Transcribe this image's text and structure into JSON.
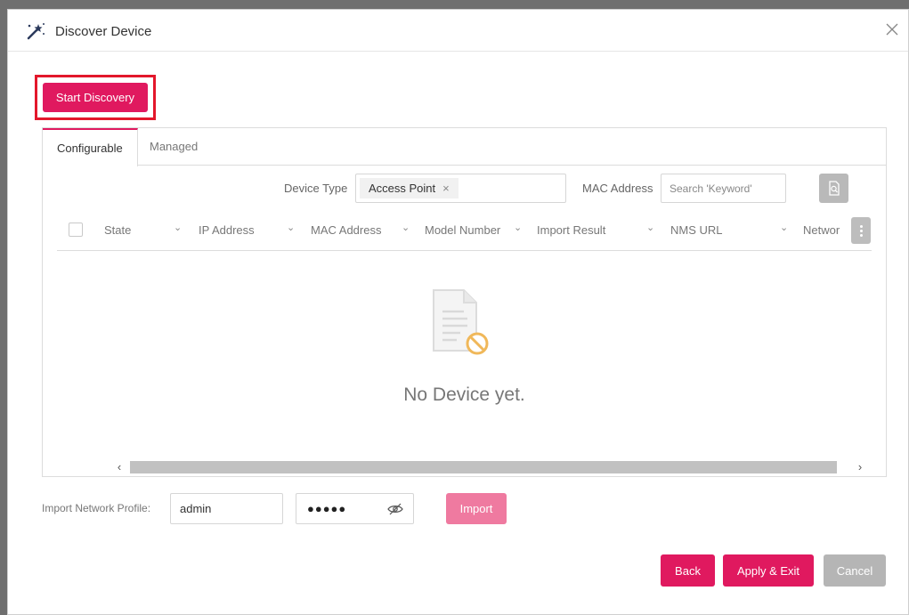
{
  "dialog": {
    "title": "Discover Device",
    "title_icon": "magic-wand-icon",
    "close_icon": "close-icon"
  },
  "toolbar": {
    "start_discovery_label": "Start Discovery"
  },
  "tabs": [
    {
      "label": "Configurable",
      "active": true
    },
    {
      "label": "Managed",
      "active": false
    }
  ],
  "filters": {
    "device_type_label": "Device Type",
    "device_type_chip": "Access Point",
    "chip_remove": "×",
    "mac_label": "MAC Address",
    "search_placeholder": "Search 'Keyword'",
    "search_icon": "search-document-icon"
  },
  "table": {
    "columns": [
      "State",
      "IP Address",
      "MAC Address",
      "Model Number",
      "Import Result",
      "NMS URL",
      "Networ"
    ],
    "rows": [],
    "empty_text": "No Device yet.",
    "empty_icon": "no-document-icon",
    "column_menu_icon": "kebab-menu-icon"
  },
  "scroll": {
    "left_arrow": "‹",
    "right_arrow": "›"
  },
  "import": {
    "label": "Import Network Profile:",
    "username": "admin",
    "password_masked": "●●●●●",
    "eye_icon": "eye-slash-icon",
    "button_label": "Import"
  },
  "footer": {
    "back_label": "Back",
    "apply_label": "Apply & Exit",
    "cancel_label": "Cancel"
  },
  "colors": {
    "primary": "#e0195f",
    "primary_disabled": "#ef7aa0",
    "highlight_border": "#e3172b",
    "cancel": "#b5b5b5",
    "empty_icon_accent": "#f0b85a"
  }
}
